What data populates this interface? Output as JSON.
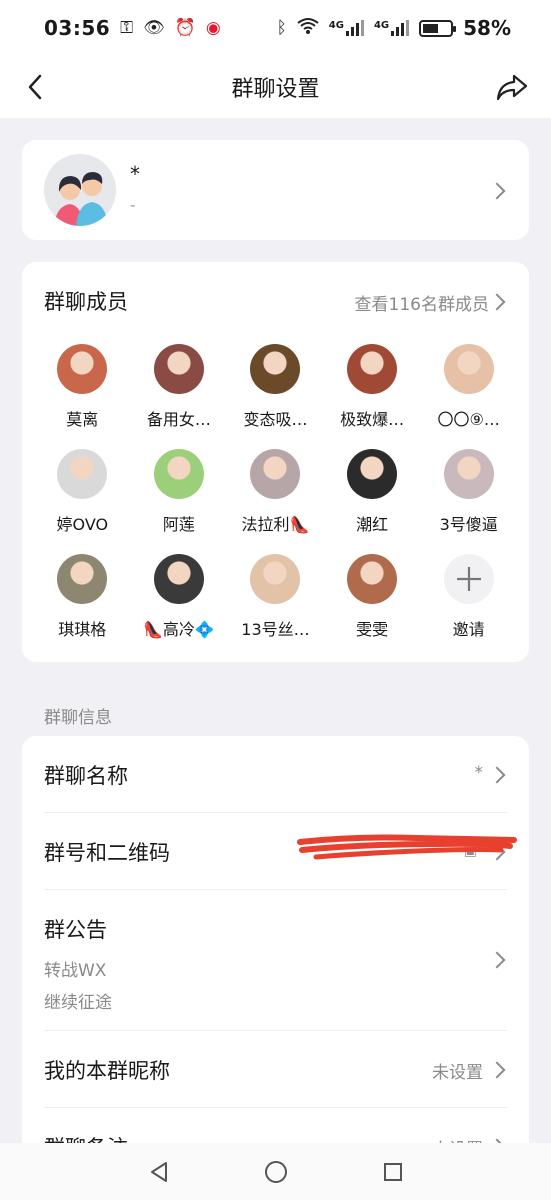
{
  "status": {
    "time": "03:56",
    "battery": "58%",
    "battery_level": 0.58,
    "network1": "4G",
    "network2": "4G"
  },
  "header": {
    "title": "群聊设置"
  },
  "group": {
    "name": "*",
    "subtitle": "-"
  },
  "members": {
    "title": "群聊成员",
    "view_all": "查看116名群成员",
    "list": [
      {
        "name": "莫离",
        "color": "#c8674a"
      },
      {
        "name": "备用女…",
        "color": "#8a4b45"
      },
      {
        "name": "变态吸…",
        "color": "#6b4a2a"
      },
      {
        "name": "极致爆…",
        "color": "#a04a36"
      },
      {
        "name": "〇〇⑨…",
        "color": "#e7c0a8"
      },
      {
        "name": "婷OVO",
        "color": "#d9d9d9"
      },
      {
        "name": "阿莲",
        "color": "#9ccf7a"
      },
      {
        "name": "法拉利👠",
        "color": "#b7a6a8"
      },
      {
        "name": "潮红",
        "color": "#2b2b2b"
      },
      {
        "name": "3号傻逼",
        "color": "#c9b9bd"
      },
      {
        "name": "琪琪格",
        "color": "#8d8670"
      },
      {
        "name": "👠高冷💠",
        "color": "#3a3a3a"
      },
      {
        "name": "13号丝…",
        "color": "#e2c3a8"
      },
      {
        "name": "雯雯",
        "color": "#b06a4c"
      }
    ],
    "invite_label": "邀请"
  },
  "info": {
    "section_label": "群聊信息",
    "rows": {
      "name_label": "群聊名称",
      "name_value": "*",
      "qr_label": "群号和二维码",
      "notice_label": "群公告",
      "notice_line1": "转战WX",
      "notice_line2": "继续征途",
      "nick_label": "我的本群昵称",
      "nick_value": "未设置",
      "remark_label": "群聊备注",
      "remark_value": "未设置"
    }
  }
}
